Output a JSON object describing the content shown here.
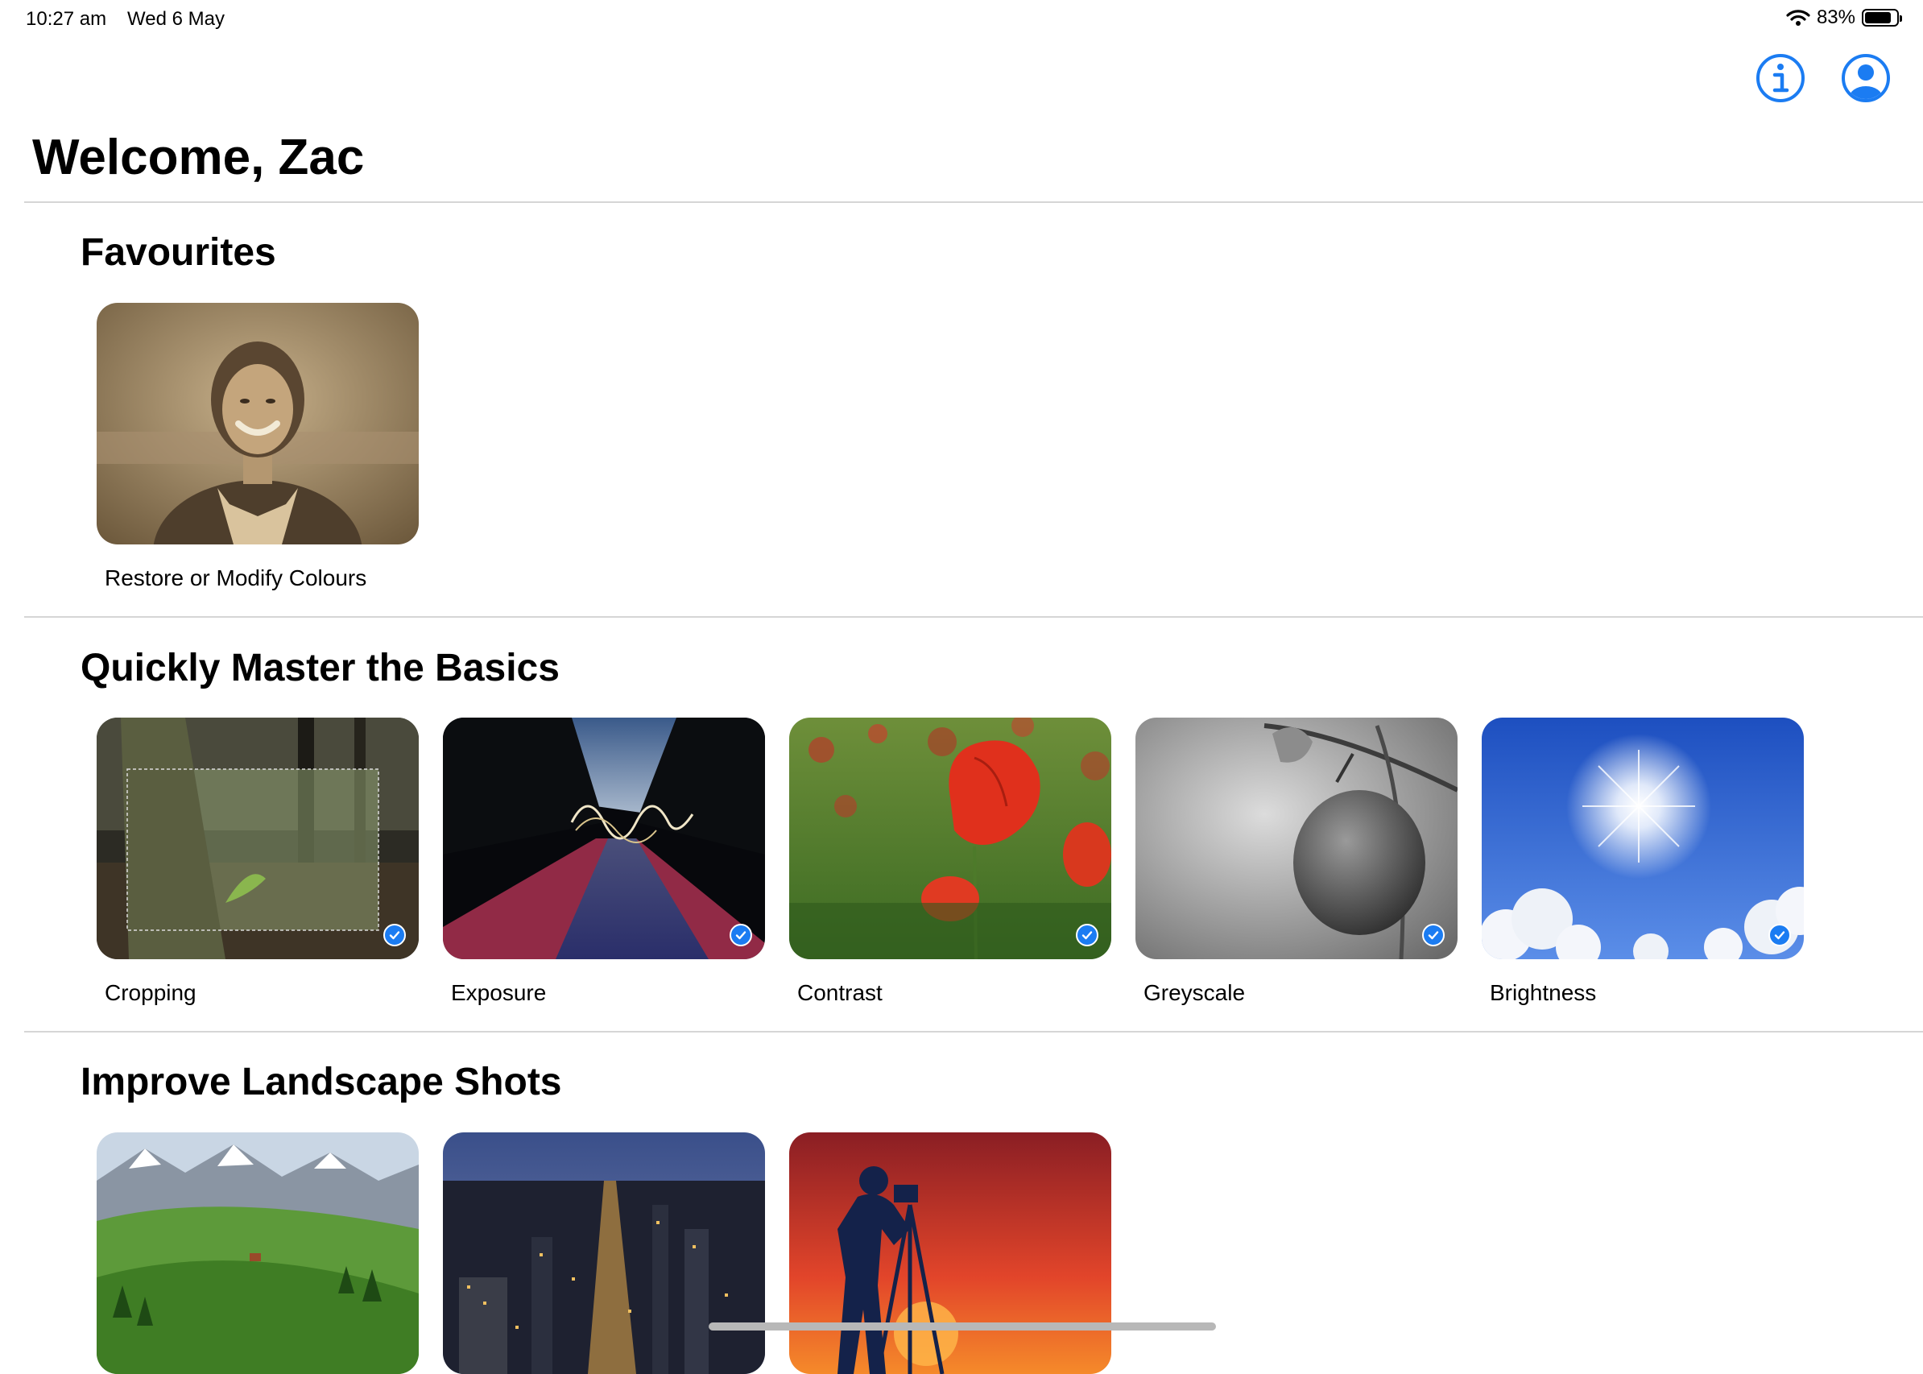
{
  "status_bar": {
    "time": "10:27 am",
    "date": "Wed 6 May",
    "battery": "83%",
    "battery_level": 0.83
  },
  "nav": {
    "info_icon": "info-icon",
    "profile_icon": "person-circle-icon"
  },
  "page_title": "Welcome, Zac",
  "colors": {
    "accent": "#1b7cf2",
    "divider": "#d6d6d6"
  },
  "sections": [
    {
      "title": "Favourites",
      "items": [
        {
          "label": "Restore or Modify Colours",
          "completed": false
        }
      ]
    },
    {
      "title": "Quickly Master the Basics",
      "items": [
        {
          "label": "Cropping",
          "completed": true
        },
        {
          "label": "Exposure",
          "completed": true
        },
        {
          "label": "Contrast",
          "completed": true
        },
        {
          "label": "Greyscale",
          "completed": true
        },
        {
          "label": "Brightness",
          "completed": true
        }
      ]
    },
    {
      "title": "Improve Landscape Shots",
      "items": [
        {
          "label": "",
          "completed": false
        },
        {
          "label": "",
          "completed": false
        },
        {
          "label": "",
          "completed": false
        }
      ]
    }
  ]
}
